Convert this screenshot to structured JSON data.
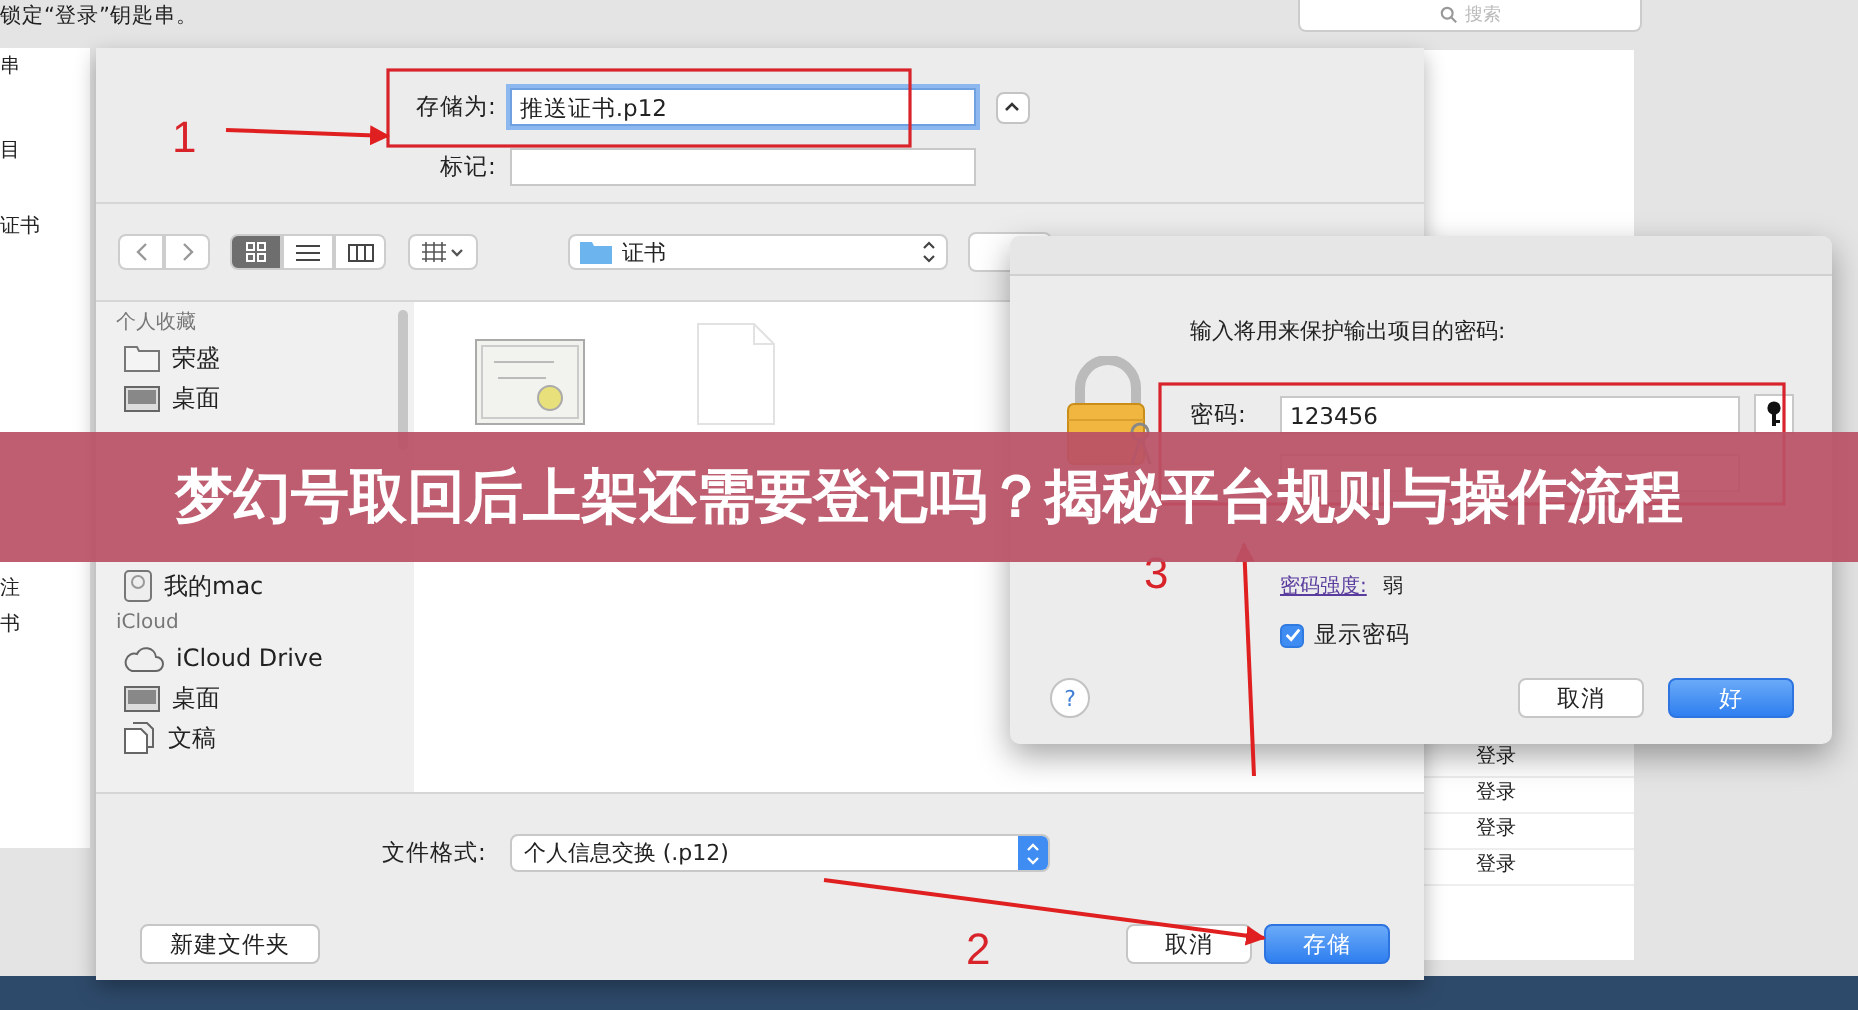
{
  "background_window": {
    "title_text": "锁定“登录”钥匙串。",
    "search_placeholder": "搜索",
    "sidebar_top": [
      "串",
      "目",
      "证书"
    ],
    "sidebar_bottom": [
      "注",
      "书"
    ],
    "list_items": [
      "登录",
      "登录",
      "登录",
      "登录"
    ]
  },
  "save_sheet": {
    "save_as_label": "存储为:",
    "save_as_value": "推送证书.p12",
    "tags_label": "标记:",
    "location": "证书",
    "view_modes": [
      {
        "kind": "icons",
        "selected": true
      },
      {
        "kind": "list",
        "selected": false
      },
      {
        "kind": "columns",
        "selected": false
      }
    ],
    "sidebar": [
      {
        "kind": "header",
        "label": "个人收藏"
      },
      {
        "kind": "folder",
        "label": "荣盛"
      },
      {
        "kind": "desktop",
        "label": "桌面"
      },
      {
        "kind": "gap"
      },
      {
        "kind": "disk",
        "label": "我的mac"
      },
      {
        "kind": "header",
        "label": "iCloud"
      },
      {
        "kind": "cloud",
        "label": "iCloud Drive"
      },
      {
        "kind": "desktop",
        "label": "桌面"
      },
      {
        "kind": "document",
        "label": "文稿"
      }
    ],
    "files": [
      {
        "kind": "certificate"
      },
      {
        "kind": "document"
      }
    ],
    "format_label": "文件格式:",
    "format_value": "个人信息交换 (.p12)",
    "new_folder": "新建文件夹",
    "buttons": [
      {
        "label": "取消",
        "primary": false
      },
      {
        "label": "存储",
        "primary": true
      }
    ]
  },
  "password_dialog": {
    "prompt": "输入将用来保护输出项目的密码:",
    "password_label": "密码:",
    "password_value": "123456",
    "strength_label": "密码强度:",
    "strength_value": "弱",
    "show_password": {
      "label": "显示密码",
      "checked": true
    },
    "help": "?",
    "buttons": [
      {
        "label": "取消",
        "primary": false
      },
      {
        "label": "好",
        "primary": true
      }
    ]
  },
  "banner": {
    "title": "梦幻号取回后上架还需要登记吗？揭秘平台规则与操作流程"
  },
  "annotations": [
    {
      "label": "1"
    },
    {
      "label": "2"
    },
    {
      "label": "3"
    }
  ]
}
